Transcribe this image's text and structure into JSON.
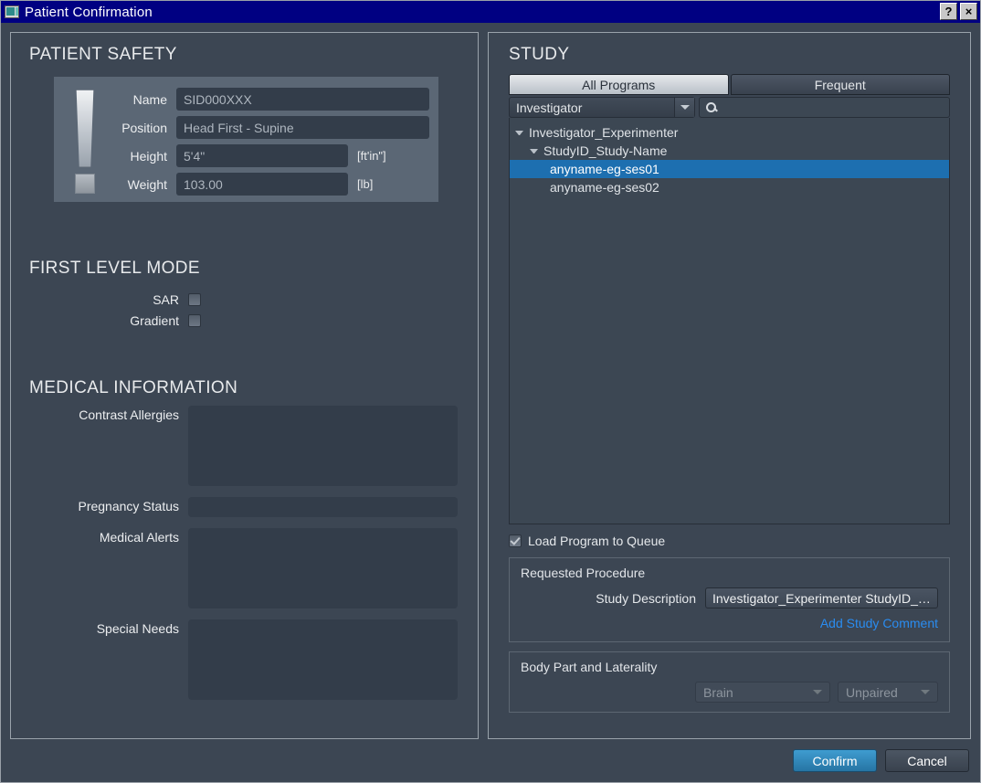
{
  "window": {
    "title": "Patient Confirmation",
    "icon": "window-monitor-icon",
    "help_label": "?",
    "close_label": "×"
  },
  "patient_safety": {
    "title": "PATIENT SAFETY",
    "warning_icon": "exclamation-warning-icon",
    "fields": [
      {
        "label": "Name",
        "value": "SID000XXX",
        "unit": ""
      },
      {
        "label": "Position",
        "value": "Head First - Supine",
        "unit": ""
      },
      {
        "label": "Height",
        "value": "5'4\"",
        "unit": "[ft'in\"]"
      },
      {
        "label": "Weight",
        "value": "103.00",
        "unit": "[lb]"
      }
    ]
  },
  "first_level_mode": {
    "title": "FIRST LEVEL MODE",
    "items": [
      {
        "label": "SAR",
        "checked": false
      },
      {
        "label": "Gradient",
        "checked": false
      }
    ]
  },
  "medical_information": {
    "title": "MEDICAL INFORMATION",
    "fields": [
      {
        "label": "Contrast Allergies",
        "value": "",
        "size": "large"
      },
      {
        "label": "Pregnancy Status",
        "value": "",
        "size": "small"
      },
      {
        "label": "Medical Alerts",
        "value": "",
        "size": "large"
      },
      {
        "label": "Special Needs",
        "value": "",
        "size": "large"
      }
    ]
  },
  "study": {
    "title": "STUDY",
    "tabs": [
      {
        "label": "All Programs",
        "active": true
      },
      {
        "label": "Frequent",
        "active": false
      }
    ],
    "filter": {
      "selected": "Investigator",
      "dropdown_icon": "chevron-down-icon"
    },
    "search": {
      "value": "",
      "placeholder": "",
      "icon": "search-icon"
    },
    "tree": [
      {
        "label": "Investigator_Experimenter",
        "level": 0,
        "expanded": true,
        "selected": false
      },
      {
        "label": "StudyID_Study-Name",
        "level": 1,
        "expanded": true,
        "selected": false
      },
      {
        "label": "anyname-eg-ses01",
        "level": 2,
        "expanded": null,
        "selected": true
      },
      {
        "label": "anyname-eg-ses02",
        "level": 2,
        "expanded": null,
        "selected": false
      }
    ],
    "load_queue": {
      "label": "Load Program to Queue",
      "checked": true
    },
    "requested_procedure": {
      "title": "Requested Procedure",
      "study_description_label": "Study Description",
      "study_description_value": "Investigator_Experimenter StudyID_…",
      "add_comment_link": "Add Study Comment"
    },
    "body_part": {
      "title": "Body Part and Laterality",
      "part_value": "Brain",
      "laterality_value": "Unpaired",
      "dropdown_icon": "chevron-down-icon"
    }
  },
  "footer": {
    "confirm_label": "Confirm",
    "cancel_label": "Cancel"
  },
  "colors": {
    "titlebar": "#000082",
    "background": "#3c4653",
    "accent_selection": "#1d6fb0",
    "link": "#2a8cf0",
    "confirm_button": "#2f86bb"
  }
}
